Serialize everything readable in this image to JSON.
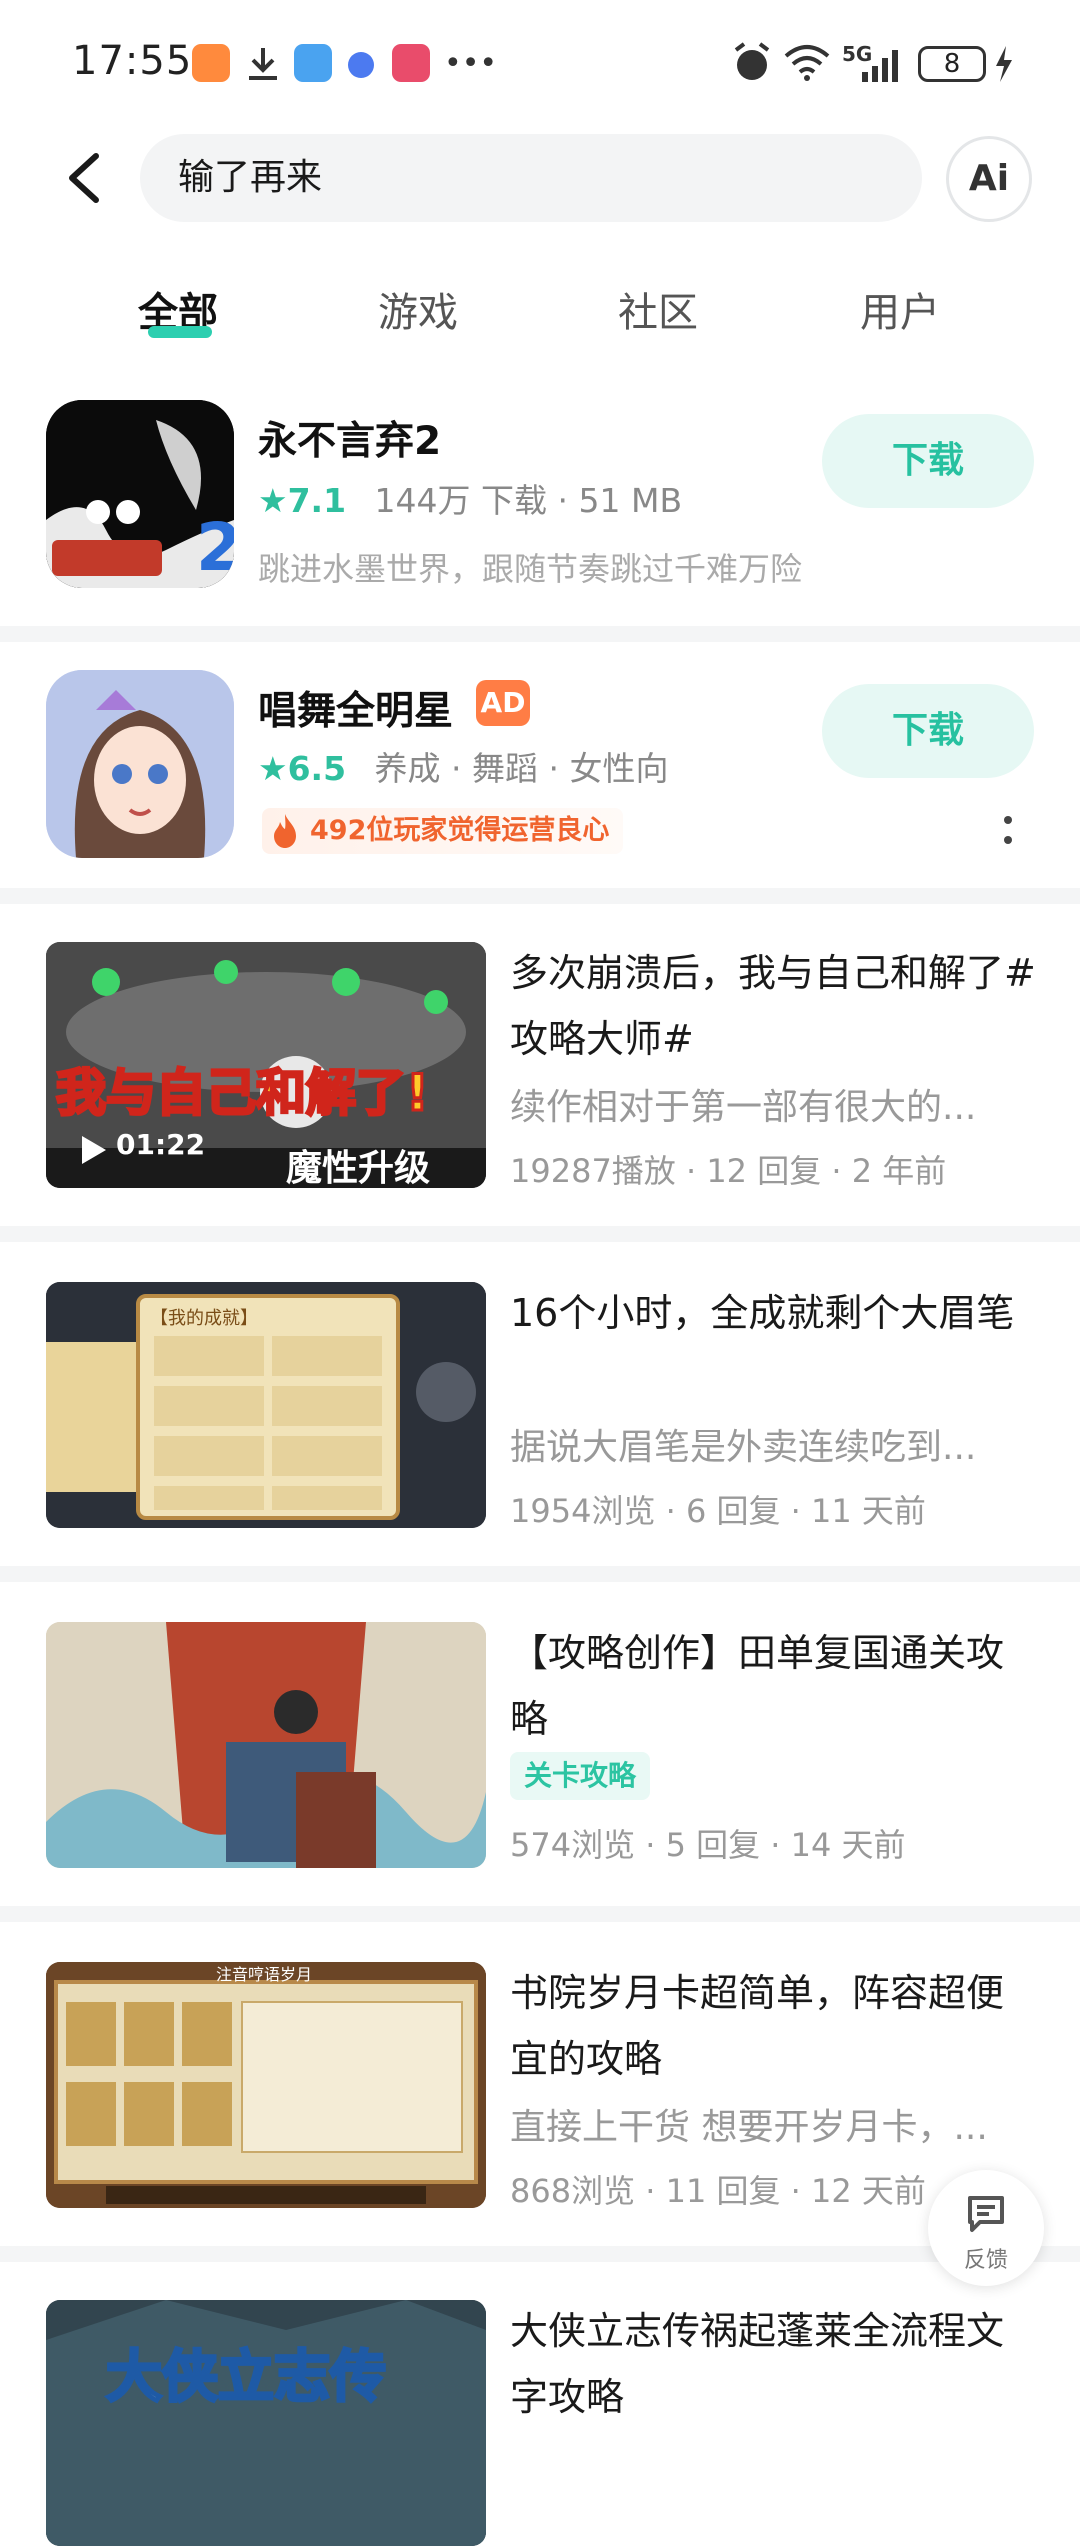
{
  "status_bar": {
    "time": "17:55",
    "battery": "8",
    "network": "5G"
  },
  "search": {
    "query": "输了再来",
    "ai_label": "Ai"
  },
  "tabs": [
    {
      "label": "全部",
      "active": true
    },
    {
      "label": "游戏",
      "active": false
    },
    {
      "label": "社区",
      "active": false
    },
    {
      "label": "用户",
      "active": false
    }
  ],
  "apps": [
    {
      "name": "永不言弃2",
      "rating": "★7.1",
      "meta": "144万 下载 · 51 MB",
      "description": "跳进水墨世界，跟随节奏跳过千难万险",
      "download_label": "下载",
      "icon": "game-icon-ink-character"
    },
    {
      "name": "唱舞全明星",
      "ad_badge": "AD",
      "rating": "★6.5",
      "meta": "养成 · 舞蹈 · 女性向",
      "hot_tag": "492位玩家觉得运营良心",
      "download_label": "下载",
      "icon": "game-icon-anime-girl"
    }
  ],
  "posts": [
    {
      "title": "多次崩溃后，我与自己和解了#攻略大师#",
      "description": "续作相对于第一部有很大的...",
      "stats": "19287播放 · 12 回复 · 2 年前",
      "thumb_caption": "我与自己和解了!",
      "thumb_bottom": "魔性升级",
      "duration": "01:22",
      "is_video": true
    },
    {
      "title": "16个小时，全成就剩个大眉笔",
      "description": "据说大眉笔是外卖连续吃到...",
      "stats": "1954浏览 · 6 回复 · 11 天前",
      "thumb_header": "【我的成就】"
    },
    {
      "title": "【攻略创作】田单复国通关攻略",
      "tag": "关卡攻略",
      "stats": "574浏览 · 5 回复 · 14 天前"
    },
    {
      "title": "书院岁月卡超简单，阵容超便宜的攻略",
      "description": "直接上干货 想要开岁月卡，...",
      "stats": "868浏览 · 11 回复 · 12 天前",
      "thumb_header": "注音哼语岁月"
    },
    {
      "title": "大侠立志传祸起蓬莱全流程文字攻略",
      "thumb_caption": "大侠立志传"
    }
  ],
  "feedback": {
    "label": "反馈"
  },
  "colors": {
    "accent": "#2ccfb0",
    "download_bg": "#e6f8f4",
    "ad_orange": "#ff7d45",
    "hot_text": "#f0642e"
  }
}
